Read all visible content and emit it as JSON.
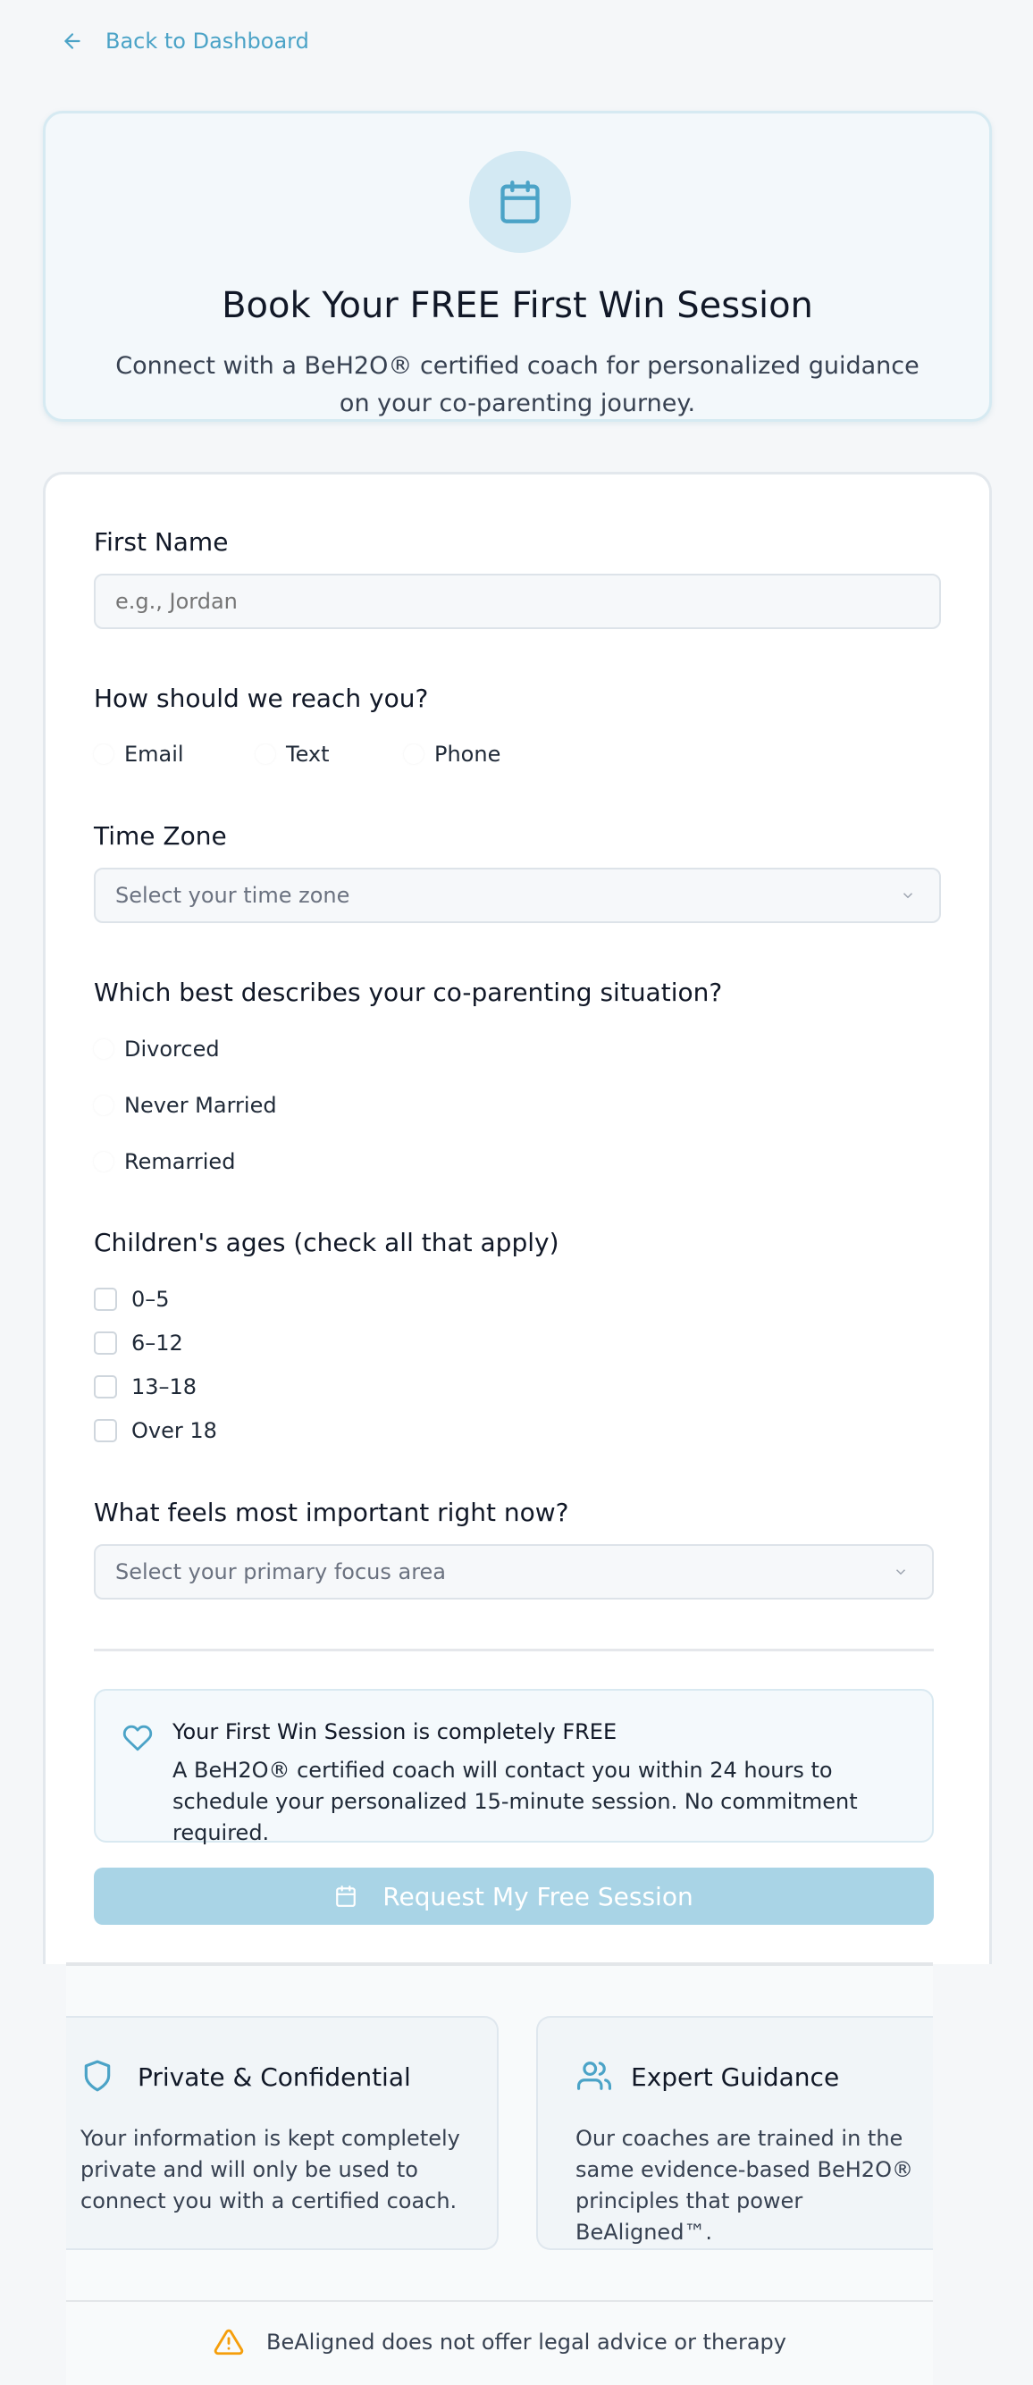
{
  "nav": {
    "back_label": "Back to Dashboard"
  },
  "hero": {
    "icon": "calendar-icon",
    "title": "Book Your FREE First Win Session",
    "subtitle": "Connect with a BeH2O® certified coach for personalized guidance on your co-parenting journey."
  },
  "form": {
    "first_name": {
      "label": "First Name",
      "placeholder": "e.g., Jordan"
    },
    "contact": {
      "label": "How should we reach you?",
      "options": [
        "Email",
        "Text",
        "Phone"
      ]
    },
    "timezone": {
      "label": "Time Zone",
      "placeholder": "Select your time zone"
    },
    "situation": {
      "label": "Which best describes your co-parenting situation?",
      "options": [
        "Divorced",
        "Never Married",
        "Remarried"
      ]
    },
    "ages": {
      "label": "Children's ages (check all that apply)",
      "options": [
        "0–5",
        "6–12",
        "13–18",
        "Over 18"
      ]
    },
    "focus": {
      "label": "What feels most important right now?",
      "placeholder": "Select your primary focus area"
    },
    "info": {
      "icon": "heart-icon",
      "title": "Your First Win Session is completely FREE",
      "text": "A BeH2O® certified coach will contact you within 24 hours to schedule your personalized 15-minute session. No commitment required."
    },
    "submit_label": "Request My Free Session"
  },
  "features": [
    {
      "icon": "shield-icon",
      "title": "Private & Confidential",
      "text": "Your information is kept completely private and will only be used to connect you with a certified coach."
    },
    {
      "icon": "users-icon",
      "title": "Expert Guidance",
      "text": "Our coaches are trained in the same evidence-based BeH2O® principles that power BeAligned™."
    }
  ],
  "disclaimer": {
    "icon": "warning-icon",
    "text": "BeAligned does not offer legal advice or therapy"
  },
  "colors": {
    "accent": "#4ba3c7",
    "button_disabled": "#a9d4e6",
    "warning": "#f59e0b"
  }
}
